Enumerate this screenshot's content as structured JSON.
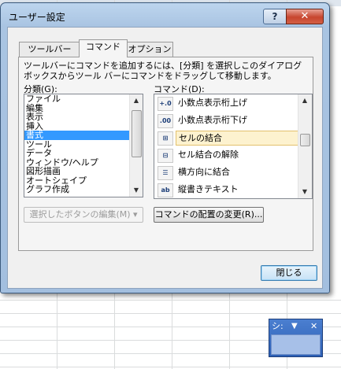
{
  "dialog": {
    "title": "ユーザー設定",
    "help_glyph": "?",
    "close_glyph": "✕"
  },
  "tabs": [
    {
      "label": "ツールバー"
    },
    {
      "label": "コマンド"
    },
    {
      "label": "オプション"
    }
  ],
  "description": "ツールバーにコマンドを追加するには、[分類] を選択しこのダイアログ ボックスからツール バーにコマンドをドラッグして移動します。",
  "categories": {
    "label": "分類(G):",
    "items": [
      "ファイル",
      "編集",
      "表示",
      "挿入",
      "書式",
      "ツール",
      "データ",
      "ウィンドウ/ヘルプ",
      "図形描画",
      "オートシェイプ",
      "グラフ作成"
    ],
    "selected": "書式"
  },
  "commands": {
    "label": "コマンド(D):",
    "items": [
      {
        "label": "小数点表示桁上げ",
        "icon": "increase-decimal-icon",
        "glyph": "+.0"
      },
      {
        "label": "小数点表示桁下げ",
        "icon": "decrease-decimal-icon",
        "glyph": ".00"
      },
      {
        "label": "セルの結合",
        "icon": "merge-cells-icon",
        "glyph": "⊞"
      },
      {
        "label": "セル結合の解除",
        "icon": "unmerge-cells-icon",
        "glyph": "⊟"
      },
      {
        "label": "横方向に結合",
        "icon": "merge-across-icon",
        "glyph": "☰"
      },
      {
        "label": "縦書きテキスト",
        "icon": "vertical-text-icon",
        "glyph": "ab"
      }
    ],
    "selected": "セルの結合"
  },
  "buttons": {
    "modify_selection": "選択したボタンの編集(M) ▾",
    "rearrange_commands": "コマンドの配置の変更(R)...",
    "close": "閉じる"
  },
  "floating_toolbar": {
    "title": "シ:",
    "dropdown_glyph": "▼",
    "close_glyph": "✕"
  }
}
